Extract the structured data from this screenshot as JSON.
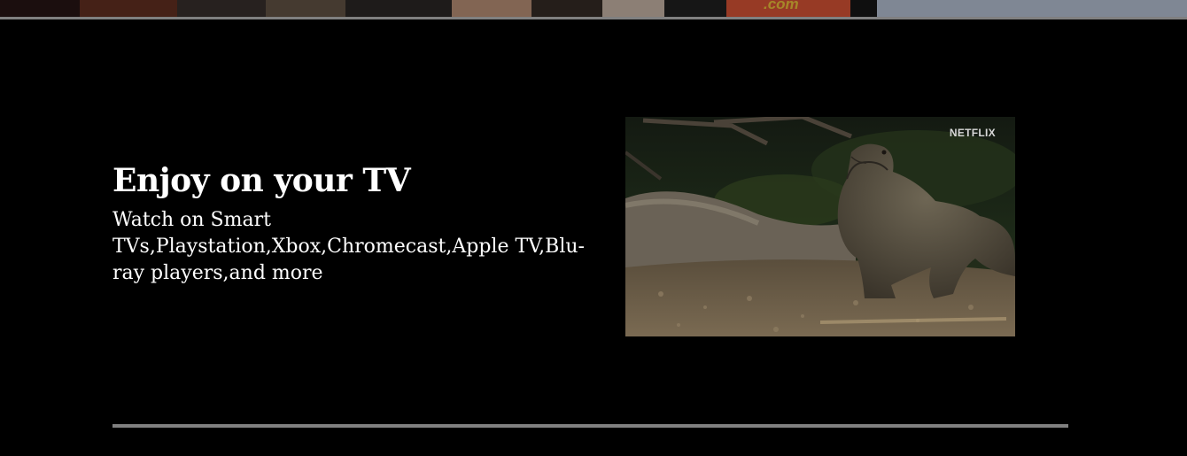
{
  "feature": {
    "title": "Enjoy on your TV",
    "subtitle": "Watch on Smart TVs,Playstation,Xbox,Chromecast,Apple TV,Blu-ray players,and more",
    "media": {
      "brand_watermark": "NETFLIX",
      "subject_icon": "komodo-dragon-video-still"
    }
  },
  "hero": {
    "collage_text": ".com"
  },
  "colors": {
    "background": "#000000",
    "divider": "#808080",
    "text": "#ffffff"
  }
}
